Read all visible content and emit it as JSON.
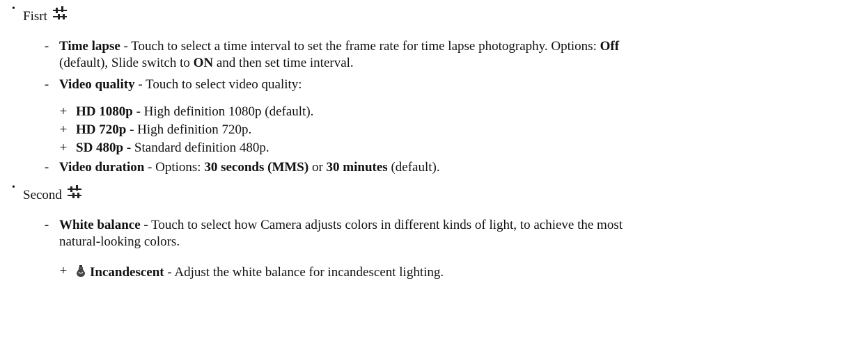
{
  "sections": [
    {
      "title": "Fisrt",
      "items": [
        {
          "label": "Time lapse",
          "text1": " - Touch to select a time interval to set the frame rate for time lapse photography. Options: ",
          "bold1": "Off",
          "text2": "(default), Slide switch to ",
          "bold2": "ON",
          "text3": " and then set time interval."
        },
        {
          "label": "Video quality",
          "text1": " - Touch to select video quality:",
          "subitems": [
            {
              "label": "HD 1080p",
              "text": " - High definition 1080p (default)."
            },
            {
              "label": "HD 720p",
              "text": " - High definition 720p."
            },
            {
              "label": "SD 480p",
              "text": " - Standard definition 480p."
            }
          ]
        },
        {
          "label": "Video duration",
          "text1": " - Options: ",
          "bold1": "30 seconds (MMS)",
          "text2": " or ",
          "bold2": "30 minutes",
          "text3": " (default)."
        }
      ]
    },
    {
      "title": "Second",
      "items": [
        {
          "label": "White balance",
          "text1": " - Touch to select how Camera adjusts colors in different kinds of light, to achieve the most",
          "text2": "natural-looking colors.",
          "subitems": [
            {
              "label": "Incandescent",
              "text": " - Adjust the white balance for incandescent lighting."
            }
          ]
        }
      ]
    }
  ],
  "markers": {
    "bullet": "•",
    "dash": "-",
    "plus": "+"
  }
}
